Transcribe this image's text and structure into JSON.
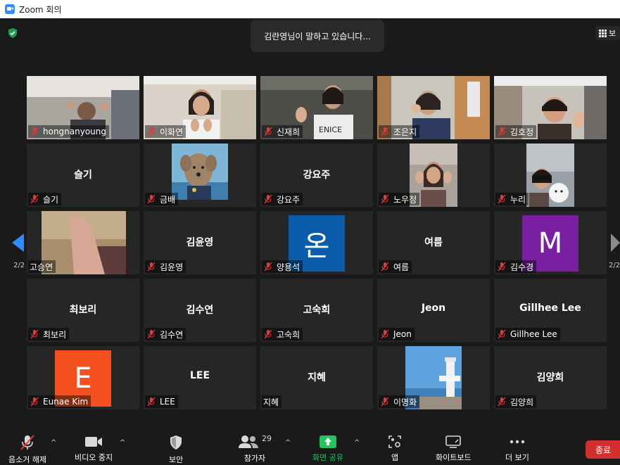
{
  "window": {
    "title": "Zoom 회의"
  },
  "banner": {
    "speaking": "김란영님이 말하고 있습니다..."
  },
  "view": {
    "label": "보"
  },
  "pagination": {
    "left": "2/2",
    "right": "2/2"
  },
  "colors": {
    "accent": "#2d8cff",
    "end": "#d22f2f",
    "share": "#22c55e",
    "muted": "#e03a3a"
  },
  "tiles": [
    {
      "name": "hongnanyoung",
      "muted": true,
      "kind": "video"
    },
    {
      "name": "이화연",
      "muted": true,
      "kind": "video"
    },
    {
      "name": "신재희",
      "muted": true,
      "kind": "video"
    },
    {
      "name": "조은지",
      "muted": true,
      "kind": "video"
    },
    {
      "name": "김호정",
      "muted": true,
      "kind": "video"
    },
    {
      "name": "슬기",
      "display": "슬기",
      "muted": true,
      "kind": "text"
    },
    {
      "name": "금배",
      "muted": true,
      "kind": "picture"
    },
    {
      "name": "강요주",
      "display": "강요주",
      "muted": true,
      "kind": "text"
    },
    {
      "name": "노우정",
      "muted": true,
      "kind": "picture"
    },
    {
      "name": "누리",
      "muted": true,
      "kind": "picture"
    },
    {
      "name": "고승연",
      "muted": false,
      "kind": "video"
    },
    {
      "name": "김윤영",
      "display": "김윤영",
      "muted": true,
      "kind": "text"
    },
    {
      "name": "양용석",
      "avatar": "온",
      "avatar_color": "#0b5cab",
      "muted": true,
      "kind": "avatar"
    },
    {
      "name": "여름",
      "display": "여름",
      "muted": true,
      "kind": "text"
    },
    {
      "name": "김수경",
      "avatar": "M",
      "avatar_color": "#7b1fa2",
      "muted": true,
      "kind": "avatar"
    },
    {
      "name": "최보리",
      "display": "최보리",
      "muted": true,
      "kind": "text"
    },
    {
      "name": "김수연",
      "display": "김수연",
      "muted": true,
      "kind": "text"
    },
    {
      "name": "고숙희",
      "display": "고숙희",
      "muted": true,
      "kind": "text"
    },
    {
      "name": "Jeon",
      "display": "Jeon",
      "muted": true,
      "kind": "text"
    },
    {
      "name": "Gillhee Lee",
      "display": "Gillhee Lee",
      "muted": true,
      "kind": "text"
    },
    {
      "name": "Eunae Kim",
      "avatar": "E",
      "avatar_color": "#f4511e",
      "muted": true,
      "kind": "avatar"
    },
    {
      "name": "LEE",
      "display": "LEE",
      "muted": true,
      "kind": "text"
    },
    {
      "name": "지혜",
      "display": "지혜",
      "muted": false,
      "kind": "text"
    },
    {
      "name": "이명화",
      "muted": true,
      "kind": "picture"
    },
    {
      "name": "김양희",
      "display": "김양희",
      "muted": true,
      "kind": "text"
    }
  ],
  "toolbar": {
    "unmute": "음소거 해제",
    "video": "비디오 중지",
    "security": "보안",
    "participants": "참가자",
    "participants_count": "29",
    "share": "화면 공유",
    "apps": "앱",
    "whiteboard": "화이트보드",
    "more": "더 보기",
    "end": "종료"
  }
}
